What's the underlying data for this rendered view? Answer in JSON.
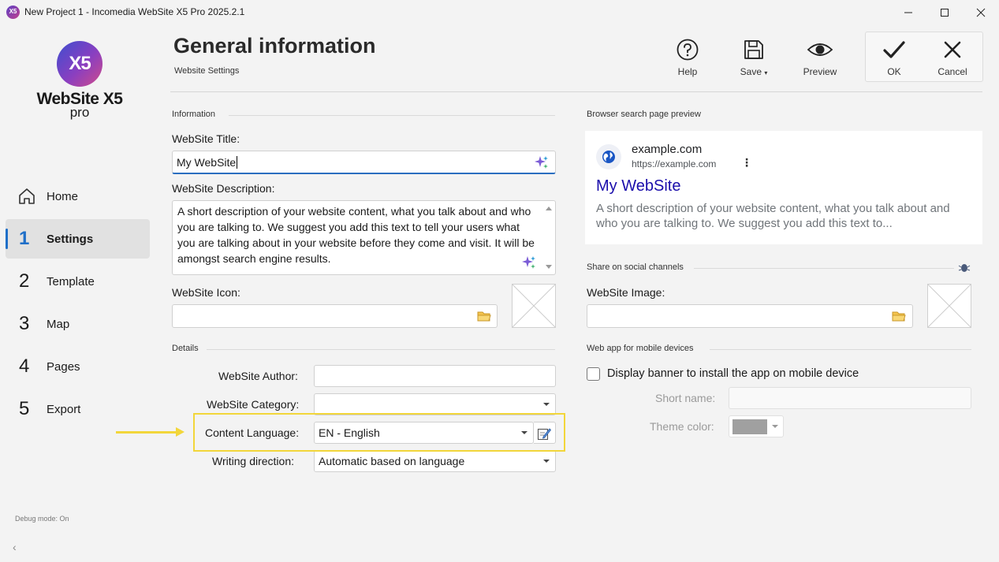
{
  "window": {
    "title": "New Project 1 - Incomedia WebSite X5 Pro 2025.2.1",
    "app_icon_text": "X5"
  },
  "sidebar": {
    "logo_mark": "X5",
    "logo_name": "WebSite X5",
    "logo_edition": "pro",
    "items": [
      {
        "num": "",
        "label": "Home",
        "icon": "home-icon"
      },
      {
        "num": "1",
        "label": "Settings",
        "active": true
      },
      {
        "num": "2",
        "label": "Template"
      },
      {
        "num": "3",
        "label": "Map"
      },
      {
        "num": "4",
        "label": "Pages"
      },
      {
        "num": "5",
        "label": "Export"
      }
    ],
    "debug": "Debug mode: On",
    "collapse_glyph": "‹"
  },
  "header": {
    "title": "General information",
    "subtitle": "Website Settings",
    "tools": {
      "help": "Help",
      "save": "Save",
      "preview": "Preview",
      "ok": "OK",
      "cancel": "Cancel"
    }
  },
  "information": {
    "section": "Information",
    "title_label": "WebSite Title:",
    "title_value": "My WebSite",
    "description_label": "WebSite Description:",
    "description_value": "A short description of your website content, what you talk about and who you are talking to. We suggest you add  this text to tell your users what you are talking about in your website before they come and visit. It will be amongst search engine results.",
    "icon_label": "WebSite Icon:",
    "icon_value": ""
  },
  "details": {
    "section": "Details",
    "author_label": "WebSite Author:",
    "author_value": "",
    "category_label": "WebSite Category:",
    "category_value": "",
    "language_label": "Content Language:",
    "language_value": "EN - English",
    "direction_label": "Writing direction:",
    "direction_value": "Automatic based on language"
  },
  "search_preview": {
    "section": "Browser search page preview",
    "domain": "example.com",
    "url": "https://example.com",
    "menu_glyph": "⋮",
    "title": "My WebSite",
    "description": "A short description of your website content, what you talk about and who you are talking to. We suggest you add  this text to..."
  },
  "social": {
    "section": "Share on social channels",
    "image_label": "WebSite Image:",
    "image_value": ""
  },
  "webapp": {
    "section": "Web app for mobile devices",
    "banner_label": "Display banner to install the app on mobile device",
    "banner_checked": false,
    "short_name_label": "Short name:",
    "short_name_value": "",
    "theme_color_label": "Theme color:",
    "theme_color_value": "#a0a0a0"
  },
  "colors": {
    "accent": "#1f6fc8",
    "highlight": "#f2d63a",
    "link_title": "#1a0dab"
  }
}
